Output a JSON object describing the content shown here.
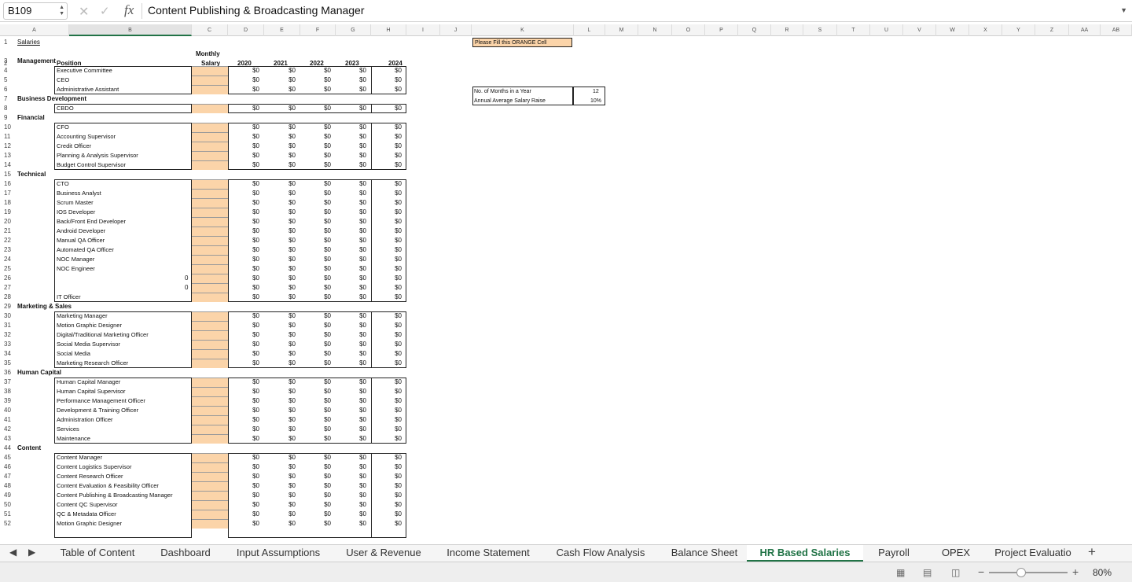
{
  "formula_bar": {
    "cell_ref": "B109",
    "formula": "Content Publishing & Broadcasting Manager"
  },
  "columns": [
    "A",
    "B",
    "C",
    "D",
    "E",
    "F",
    "G",
    "H",
    "I",
    "J",
    "K",
    "L",
    "M",
    "N",
    "O",
    "P",
    "Q",
    "R",
    "S",
    "T",
    "U",
    "V",
    "W",
    "X",
    "Y",
    "Z",
    "AA",
    "AB"
  ],
  "header": {
    "salaries": "Salaries",
    "position": "Position",
    "monthly": "Monthly",
    "salary": "Salary",
    "years": [
      "2020",
      "2021",
      "2022",
      "2023",
      "2024"
    ]
  },
  "note": "Please Fill this ORANGE Cell",
  "params": [
    {
      "label": "No. of Months in a Year",
      "value": "12"
    },
    {
      "label": "Annual Average Salary Raise",
      "value": "10%"
    }
  ],
  "money": "$0",
  "rows": [
    {
      "n": "3",
      "cat": "Management"
    },
    {
      "n": "4",
      "pos": "Executive Committee"
    },
    {
      "n": "5",
      "pos": "CEO"
    },
    {
      "n": "6",
      "pos": "Administrative Assistant"
    },
    {
      "n": "7",
      "cat": "Business Development"
    },
    {
      "n": "8",
      "pos": "CBDO"
    },
    {
      "n": "9",
      "cat": "Financial"
    },
    {
      "n": "10",
      "pos": "CFO"
    },
    {
      "n": "11",
      "pos": "Accounting Supervisor"
    },
    {
      "n": "12",
      "pos": "Credit Officer"
    },
    {
      "n": "13",
      "pos": "Planning & Analysis Supervisor"
    },
    {
      "n": "14",
      "pos": "Budget Control Supervisor"
    },
    {
      "n": "15",
      "cat": "Technical"
    },
    {
      "n": "16",
      "pos": "CTO"
    },
    {
      "n": "17",
      "pos": "Business Analyst"
    },
    {
      "n": "18",
      "pos": "Scrum Master"
    },
    {
      "n": "19",
      "pos": "IOS Developer"
    },
    {
      "n": "20",
      "pos": "Back/Front End Developer"
    },
    {
      "n": "21",
      "pos": "Android Developer"
    },
    {
      "n": "22",
      "pos": "Manual QA Officer"
    },
    {
      "n": "23",
      "pos": "Automated QA Officer"
    },
    {
      "n": "24",
      "pos": "NOC Manager"
    },
    {
      "n": "25",
      "pos": "NOC Engineer"
    },
    {
      "n": "26",
      "pos": "",
      "zero": "0"
    },
    {
      "n": "27",
      "pos": "",
      "zero": "0"
    },
    {
      "n": "28",
      "pos": "IT Officer"
    },
    {
      "n": "29",
      "cat": "Marketing & Sales"
    },
    {
      "n": "30",
      "pos": "Marketing Manager"
    },
    {
      "n": "31",
      "pos": "Motion Graphic Designer"
    },
    {
      "n": "32",
      "pos": "Digital/Traditional Marketing Officer"
    },
    {
      "n": "33",
      "pos": "Social Media Supervisor"
    },
    {
      "n": "34",
      "pos": "Social Media"
    },
    {
      "n": "35",
      "pos": "Marketing Research Officer"
    },
    {
      "n": "36",
      "cat": "Human Capital"
    },
    {
      "n": "37",
      "pos": "Human Capital Manager"
    },
    {
      "n": "38",
      "pos": "Human Capital Supervisor"
    },
    {
      "n": "39",
      "pos": "Performance Management Officer"
    },
    {
      "n": "40",
      "pos": "Development & Training Officer"
    },
    {
      "n": "41",
      "pos": "Administration Officer"
    },
    {
      "n": "42",
      "pos": "Services"
    },
    {
      "n": "43",
      "pos": "Maintenance"
    },
    {
      "n": "44",
      "cat": "Content"
    },
    {
      "n": "45",
      "pos": "Content Manager"
    },
    {
      "n": "46",
      "pos": "Content Logistics Supervisor"
    },
    {
      "n": "47",
      "pos": "Content Research Officer"
    },
    {
      "n": "48",
      "pos": "Content Evaluation & Feasibility Officer"
    },
    {
      "n": "49",
      "pos": "Content Publishing & Broadcasting Manager"
    },
    {
      "n": "50",
      "pos": "Content QC Supervisor"
    },
    {
      "n": "51",
      "pos": "QC & Metadata Officer"
    },
    {
      "n": "52",
      "pos": "Motion Graphic Designer"
    }
  ],
  "tabs": [
    "Table of Content",
    "Dashboard",
    "Input Assumptions",
    "User & Revenue",
    "Income Statement",
    "Cash Flow Analysis",
    "Balance Sheet",
    "HR Based Salaries",
    "Payroll",
    "OPEX",
    "Project Evaluatio"
  ],
  "active_tab": "HR Based Salaries",
  "zoom": "80%"
}
